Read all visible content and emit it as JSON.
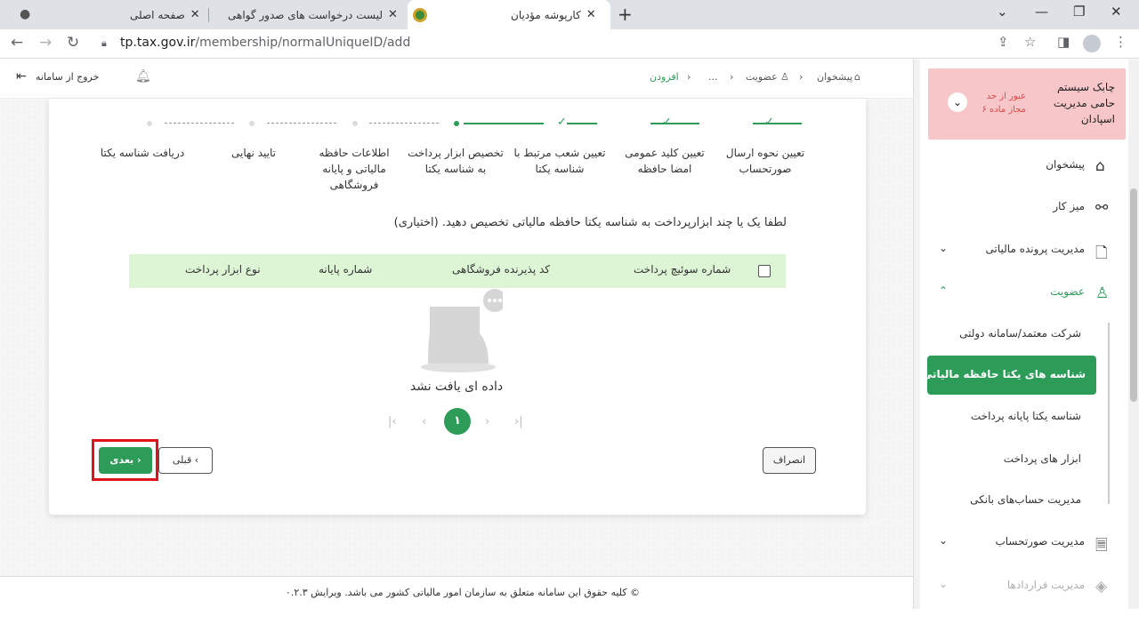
{
  "browser": {
    "tabs": [
      {
        "title": "صفحه اصلی",
        "active": false
      },
      {
        "title": "لیست درخواست های صدور گواهی",
        "active": false
      },
      {
        "title": "کارپوشه مؤدیان",
        "active": true
      }
    ],
    "url_host": "tp.tax.gov.ir",
    "url_path": "/membership/normalUniqueID/add"
  },
  "topbar": {
    "breadcrumb": [
      "پیشخوان",
      "عضویت",
      "...",
      "افزودن"
    ],
    "logout_label": "خروج از سامانه"
  },
  "stepper": {
    "steps": [
      {
        "label": "تعیین نحوه ارسال صورتحساب",
        "state": "done"
      },
      {
        "label": "تعیین کلید عمومی امضا حافظه",
        "state": "done"
      },
      {
        "label": "تعیین شعب مرتبط با شناسه یکتا",
        "state": "done"
      },
      {
        "label": "تخصیص ابزار پرداخت به شناسه یکتا",
        "state": "current"
      },
      {
        "label": "اطلاعات حافظه مالیاتی و پایانه فروشگاهی",
        "state": "pending"
      },
      {
        "label": "تایید نهایی",
        "state": "pending"
      },
      {
        "label": "دریافت شناسه یکتا",
        "state": "pending"
      }
    ]
  },
  "main": {
    "hint": "لطفا یک یا چند ابزارپرداخت به شناسه یکتا حافظه مالیاتی تخصیص دهید. (اختیاری)",
    "columns": [
      "شماره سوئیچ پرداخت",
      "کد پذیرنده فروشگاهی",
      "شماره پایانه",
      "نوع ابزار پرداخت"
    ],
    "empty_text": "داده ای یافت نشد",
    "pagination": {
      "current": "۱"
    },
    "buttons": {
      "cancel": "انصراف",
      "prev": "قبلی",
      "next": "بعدی"
    }
  },
  "footer": {
    "text": "© کلیه حقوق این سامانه متعلق به سازمان امور مالیاتی کشور می باشد. ویرایش ۰.۲.۳"
  },
  "sidebar": {
    "alert": {
      "title": "چابک سیستم حامی مدیریت اسپادان",
      "note": "عبور از حد مجاز ماده ۶"
    },
    "items": [
      {
        "label": "پیشخوان",
        "icon": "home-icon"
      },
      {
        "label": "میز کار",
        "icon": "workspace-icon"
      },
      {
        "label": "مدیریت پرونده مالیاتی",
        "icon": "file-icon"
      },
      {
        "label": "عضویت",
        "icon": "user-icon"
      }
    ],
    "sub_items": [
      "شرکت معتمد/سامانه دولتی",
      "شناسه های یکتا حافظه مالیاتی",
      "شناسه یکتا پایانه پرداخت",
      "ابزار های پرداخت",
      "مدیریت حساب‌های بانکی"
    ],
    "more_items": [
      {
        "label": "مدیریت صورتحساب",
        "icon": "invoice-icon"
      },
      {
        "label": "مدیریت قراردادها",
        "icon": "contract-icon"
      }
    ]
  },
  "colors": {
    "accent": "#2e9c59",
    "table_header_bg": "#ddf5d5",
    "alert_bg": "#f6c6c8",
    "highlight": "#e0131b"
  }
}
